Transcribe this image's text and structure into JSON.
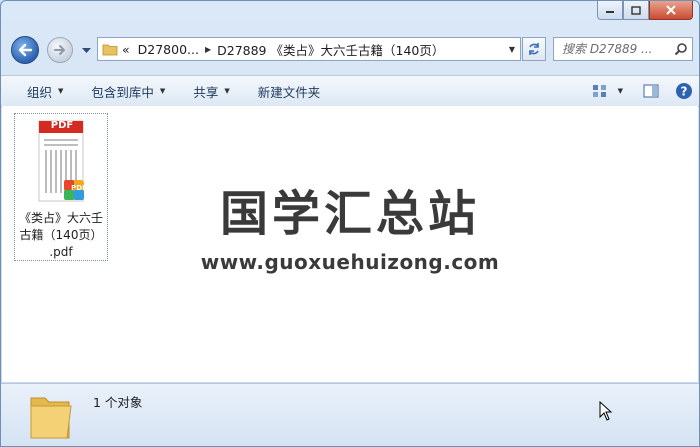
{
  "window": {
    "caption_buttons": [
      "minimize",
      "maximize",
      "close"
    ]
  },
  "address": {
    "chevron": "«",
    "segments": [
      "D27800...",
      "D27889 《类占》大六壬古籍（140页）"
    ]
  },
  "search": {
    "placeholder": "搜索 D27889 ..."
  },
  "toolbar": {
    "organize": "组织",
    "include_library": "包含到库中",
    "share": "共享",
    "new_folder": "新建文件夹"
  },
  "file": {
    "badge": "PDF",
    "name_line1": "《类占》大六壬",
    "name_line2": "古籍（140页）",
    "name_line3": ".pdf"
  },
  "watermark": {
    "title": "国学汇总站",
    "url": "www.guoxuehuizong.com"
  },
  "details": {
    "count": "1 个对象"
  },
  "colors": {
    "accent": "#2d62b0",
    "close": "#c94b31",
    "pdf_red": "#d42a20"
  }
}
